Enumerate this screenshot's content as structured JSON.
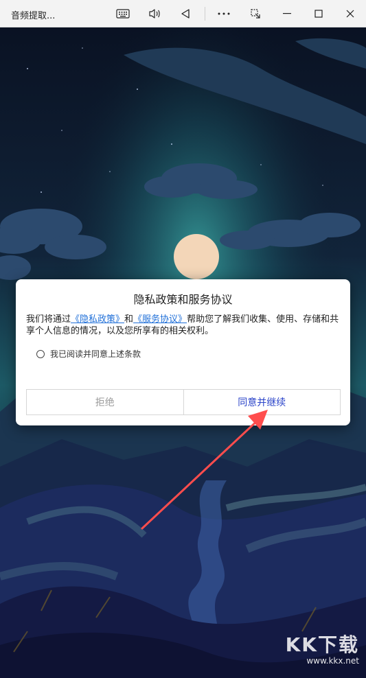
{
  "window": {
    "title": "音频提取...",
    "controls": [
      "keyboard-icon",
      "volume-icon",
      "back-icon",
      "more-icon",
      "pop-out-icon",
      "minimize-icon",
      "maximize-icon",
      "close-icon"
    ]
  },
  "dialog": {
    "title": "隐私政策和服务协议",
    "body_prefix": "我们将通过",
    "privacy_link": "《隐私政策》",
    "body_and": "和",
    "service_link": "《服务协议》",
    "body_suffix": "帮助您了解我们收集、使用、存储和共享个人信息的情况，以及您所享有的相关权利。",
    "consent_label": "我已阅读并同意上述条款",
    "reject_label": "拒绝",
    "accept_label": "同意并继续"
  },
  "colors": {
    "accent_link": "#1f6fd8",
    "accept_text": "#2b44c9",
    "reject_text": "#9b9b9b",
    "annotation_arrow": "#ff4d4d"
  },
  "watermark": {
    "logo": "KK下载",
    "url": "www.kkx.net"
  }
}
